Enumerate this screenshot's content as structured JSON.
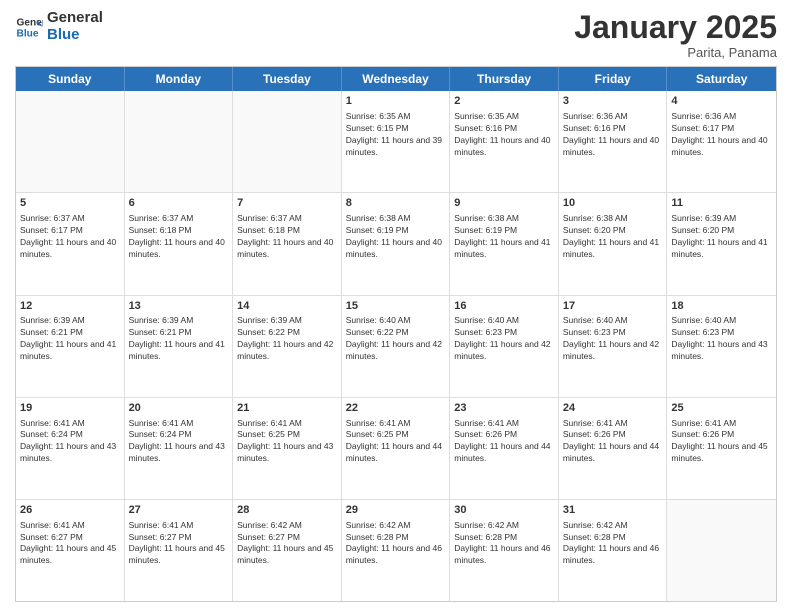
{
  "logo": {
    "line1": "General",
    "line2": "Blue"
  },
  "title": "January 2025",
  "subtitle": "Parita, Panama",
  "days": [
    "Sunday",
    "Monday",
    "Tuesday",
    "Wednesday",
    "Thursday",
    "Friday",
    "Saturday"
  ],
  "weeks": [
    [
      {
        "day": "",
        "text": ""
      },
      {
        "day": "",
        "text": ""
      },
      {
        "day": "",
        "text": ""
      },
      {
        "day": "1",
        "text": "Sunrise: 6:35 AM\nSunset: 6:15 PM\nDaylight: 11 hours and 39 minutes."
      },
      {
        "day": "2",
        "text": "Sunrise: 6:35 AM\nSunset: 6:16 PM\nDaylight: 11 hours and 40 minutes."
      },
      {
        "day": "3",
        "text": "Sunrise: 6:36 AM\nSunset: 6:16 PM\nDaylight: 11 hours and 40 minutes."
      },
      {
        "day": "4",
        "text": "Sunrise: 6:36 AM\nSunset: 6:17 PM\nDaylight: 11 hours and 40 minutes."
      }
    ],
    [
      {
        "day": "5",
        "text": "Sunrise: 6:37 AM\nSunset: 6:17 PM\nDaylight: 11 hours and 40 minutes."
      },
      {
        "day": "6",
        "text": "Sunrise: 6:37 AM\nSunset: 6:18 PM\nDaylight: 11 hours and 40 minutes."
      },
      {
        "day": "7",
        "text": "Sunrise: 6:37 AM\nSunset: 6:18 PM\nDaylight: 11 hours and 40 minutes."
      },
      {
        "day": "8",
        "text": "Sunrise: 6:38 AM\nSunset: 6:19 PM\nDaylight: 11 hours and 40 minutes."
      },
      {
        "day": "9",
        "text": "Sunrise: 6:38 AM\nSunset: 6:19 PM\nDaylight: 11 hours and 41 minutes."
      },
      {
        "day": "10",
        "text": "Sunrise: 6:38 AM\nSunset: 6:20 PM\nDaylight: 11 hours and 41 minutes."
      },
      {
        "day": "11",
        "text": "Sunrise: 6:39 AM\nSunset: 6:20 PM\nDaylight: 11 hours and 41 minutes."
      }
    ],
    [
      {
        "day": "12",
        "text": "Sunrise: 6:39 AM\nSunset: 6:21 PM\nDaylight: 11 hours and 41 minutes."
      },
      {
        "day": "13",
        "text": "Sunrise: 6:39 AM\nSunset: 6:21 PM\nDaylight: 11 hours and 41 minutes."
      },
      {
        "day": "14",
        "text": "Sunrise: 6:39 AM\nSunset: 6:22 PM\nDaylight: 11 hours and 42 minutes."
      },
      {
        "day": "15",
        "text": "Sunrise: 6:40 AM\nSunset: 6:22 PM\nDaylight: 11 hours and 42 minutes."
      },
      {
        "day": "16",
        "text": "Sunrise: 6:40 AM\nSunset: 6:23 PM\nDaylight: 11 hours and 42 minutes."
      },
      {
        "day": "17",
        "text": "Sunrise: 6:40 AM\nSunset: 6:23 PM\nDaylight: 11 hours and 42 minutes."
      },
      {
        "day": "18",
        "text": "Sunrise: 6:40 AM\nSunset: 6:23 PM\nDaylight: 11 hours and 43 minutes."
      }
    ],
    [
      {
        "day": "19",
        "text": "Sunrise: 6:41 AM\nSunset: 6:24 PM\nDaylight: 11 hours and 43 minutes."
      },
      {
        "day": "20",
        "text": "Sunrise: 6:41 AM\nSunset: 6:24 PM\nDaylight: 11 hours and 43 minutes."
      },
      {
        "day": "21",
        "text": "Sunrise: 6:41 AM\nSunset: 6:25 PM\nDaylight: 11 hours and 43 minutes."
      },
      {
        "day": "22",
        "text": "Sunrise: 6:41 AM\nSunset: 6:25 PM\nDaylight: 11 hours and 44 minutes."
      },
      {
        "day": "23",
        "text": "Sunrise: 6:41 AM\nSunset: 6:26 PM\nDaylight: 11 hours and 44 minutes."
      },
      {
        "day": "24",
        "text": "Sunrise: 6:41 AM\nSunset: 6:26 PM\nDaylight: 11 hours and 44 minutes."
      },
      {
        "day": "25",
        "text": "Sunrise: 6:41 AM\nSunset: 6:26 PM\nDaylight: 11 hours and 45 minutes."
      }
    ],
    [
      {
        "day": "26",
        "text": "Sunrise: 6:41 AM\nSunset: 6:27 PM\nDaylight: 11 hours and 45 minutes."
      },
      {
        "day": "27",
        "text": "Sunrise: 6:41 AM\nSunset: 6:27 PM\nDaylight: 11 hours and 45 minutes."
      },
      {
        "day": "28",
        "text": "Sunrise: 6:42 AM\nSunset: 6:27 PM\nDaylight: 11 hours and 45 minutes."
      },
      {
        "day": "29",
        "text": "Sunrise: 6:42 AM\nSunset: 6:28 PM\nDaylight: 11 hours and 46 minutes."
      },
      {
        "day": "30",
        "text": "Sunrise: 6:42 AM\nSunset: 6:28 PM\nDaylight: 11 hours and 46 minutes."
      },
      {
        "day": "31",
        "text": "Sunrise: 6:42 AM\nSunset: 6:28 PM\nDaylight: 11 hours and 46 minutes."
      },
      {
        "day": "",
        "text": ""
      }
    ]
  ]
}
